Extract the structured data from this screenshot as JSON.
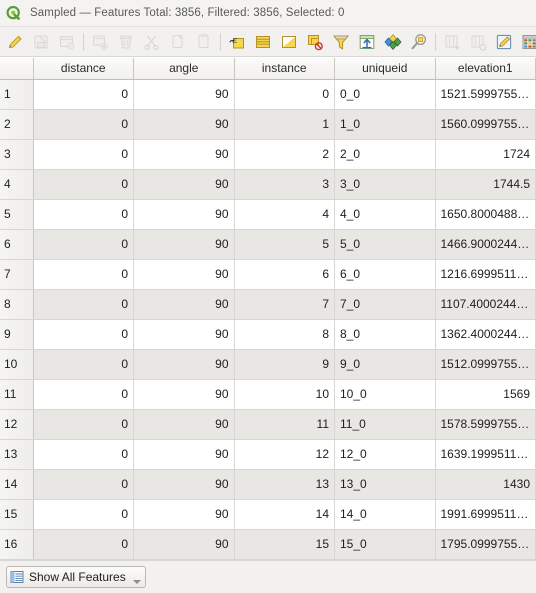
{
  "window": {
    "logo_icon": "qgis-q-icon",
    "title": "Sampled — Features Total: 3856, Filtered: 3856, Selected: 0",
    "layer_name": "Sampled",
    "features_total": 3856,
    "features_filtered": 3856,
    "features_selected": 0
  },
  "toolbar": {
    "buttons": [
      {
        "name": "toggle-editing-icon",
        "label": "Toggle editing mode",
        "enabled": true
      },
      {
        "name": "save-edits-icon",
        "label": "Save edits",
        "enabled": false
      },
      {
        "name": "reload-table-icon",
        "label": "Reload the table",
        "enabled": false
      },
      {
        "name": "add-feature-icon",
        "label": "Add feature",
        "enabled": false
      },
      {
        "name": "delete-selected-icon",
        "label": "Delete selected features",
        "enabled": false
      },
      {
        "name": "cut-features-icon",
        "label": "Cut selected features",
        "enabled": false
      },
      {
        "name": "copy-features-icon",
        "label": "Copy selected features",
        "enabled": false
      },
      {
        "name": "paste-features-icon",
        "label": "Paste features",
        "enabled": false
      },
      {
        "name": "select-by-expression-icon",
        "label": "Select features using an expression",
        "enabled": true
      },
      {
        "name": "select-all-icon",
        "label": "Select all features",
        "enabled": true
      },
      {
        "name": "invert-selection-icon",
        "label": "Invert selection",
        "enabled": true
      },
      {
        "name": "deselect-all-icon",
        "label": "Deselect all features",
        "enabled": true
      },
      {
        "name": "filter-selection-icon",
        "label": "Filter / select features",
        "enabled": true
      },
      {
        "name": "move-selection-to-top-icon",
        "label": "Move selection to top",
        "enabled": true
      },
      {
        "name": "pan-to-selection-icon",
        "label": "Pan map to selected rows",
        "enabled": true
      },
      {
        "name": "zoom-to-selection-icon",
        "label": "Zoom map to selected rows",
        "enabled": true
      },
      {
        "name": "new-column-icon",
        "label": "New field",
        "enabled": false
      },
      {
        "name": "delete-column-icon",
        "label": "Delete field",
        "enabled": false
      },
      {
        "name": "field-calculator-icon",
        "label": "Open field calculator",
        "enabled": true
      },
      {
        "name": "conditional-formatting-icon",
        "label": "Conditional formatting",
        "enabled": true
      }
    ]
  },
  "table": {
    "columns": [
      "distance",
      "angle",
      "instance",
      "uniqueid",
      "elevation1"
    ],
    "column_alignments": [
      "num",
      "num",
      "num",
      "txt",
      "num"
    ],
    "rows": [
      {
        "n": "1",
        "distance": "0",
        "angle": "90",
        "instance": "0",
        "uniqueid": "0_0",
        "elevation1": "1521.599975585..."
      },
      {
        "n": "2",
        "distance": "0",
        "angle": "90",
        "instance": "1",
        "uniqueid": "1_0",
        "elevation1": "1560.099975585..."
      },
      {
        "n": "3",
        "distance": "0",
        "angle": "90",
        "instance": "2",
        "uniqueid": "2_0",
        "elevation1": "1724"
      },
      {
        "n": "4",
        "distance": "0",
        "angle": "90",
        "instance": "3",
        "uniqueid": "3_0",
        "elevation1": "1744.5"
      },
      {
        "n": "5",
        "distance": "0",
        "angle": "90",
        "instance": "4",
        "uniqueid": "4_0",
        "elevation1": "1650.800048828..."
      },
      {
        "n": "6",
        "distance": "0",
        "angle": "90",
        "instance": "5",
        "uniqueid": "5_0",
        "elevation1": "1466.900024414..."
      },
      {
        "n": "7",
        "distance": "0",
        "angle": "90",
        "instance": "6",
        "uniqueid": "6_0",
        "elevation1": "1216.699951171..."
      },
      {
        "n": "8",
        "distance": "0",
        "angle": "90",
        "instance": "7",
        "uniqueid": "7_0",
        "elevation1": "1107.400024414..."
      },
      {
        "n": "9",
        "distance": "0",
        "angle": "90",
        "instance": "8",
        "uniqueid": "8_0",
        "elevation1": "1362.400024414..."
      },
      {
        "n": "10",
        "distance": "0",
        "angle": "90",
        "instance": "9",
        "uniqueid": "9_0",
        "elevation1": "1512.099975585..."
      },
      {
        "n": "11",
        "distance": "0",
        "angle": "90",
        "instance": "10",
        "uniqueid": "10_0",
        "elevation1": "1569"
      },
      {
        "n": "12",
        "distance": "0",
        "angle": "90",
        "instance": "11",
        "uniqueid": "11_0",
        "elevation1": "1578.599975585..."
      },
      {
        "n": "13",
        "distance": "0",
        "angle": "90",
        "instance": "12",
        "uniqueid": "12_0",
        "elevation1": "1639.199951171..."
      },
      {
        "n": "14",
        "distance": "0",
        "angle": "90",
        "instance": "13",
        "uniqueid": "13_0",
        "elevation1": "1430"
      },
      {
        "n": "15",
        "distance": "0",
        "angle": "90",
        "instance": "14",
        "uniqueid": "14_0",
        "elevation1": "1991.699951171..."
      },
      {
        "n": "16",
        "distance": "0",
        "angle": "90",
        "instance": "15",
        "uniqueid": "15_0",
        "elevation1": "1795.099975585..."
      }
    ]
  },
  "statusbar": {
    "show_all_label": "Show All Features",
    "show_all_icon": "table-filter-icon"
  },
  "colors": {
    "accent_yellow": "#f5d33f",
    "qgis_green": "#5a9e36",
    "row_alt": "#e8e7e3",
    "row_base": "#ffffff",
    "chrome": "#f2f1ef"
  }
}
